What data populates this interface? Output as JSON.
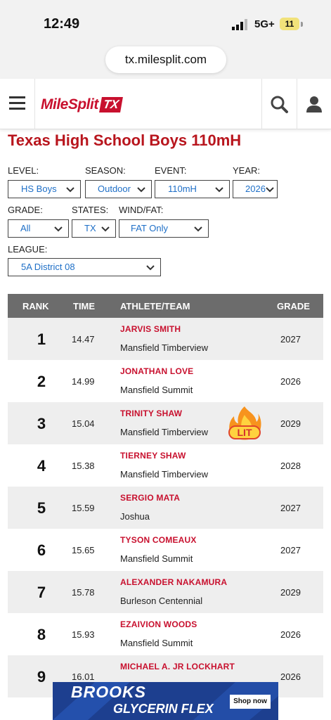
{
  "status_bar": {
    "time": "12:49",
    "network": "5G+",
    "battery": "11"
  },
  "browser": {
    "url": "tx.milesplit.com"
  },
  "header": {
    "logo_text": "MileSplit",
    "logo_badge": "TX"
  },
  "page": {
    "title": "Texas High School Boys 110mH"
  },
  "filters": {
    "level": {
      "label": "LEVEL:",
      "value": "HS Boys"
    },
    "season": {
      "label": "SEASON:",
      "value": "Outdoor"
    },
    "event": {
      "label": "EVENT:",
      "value": "110mH"
    },
    "year": {
      "label": "YEAR:",
      "value": "2026"
    },
    "grade": {
      "label": "GRADE:",
      "value": "All"
    },
    "states": {
      "label": "STATES:",
      "value": "TX"
    },
    "wind": {
      "label": "WIND/FAT:",
      "value": "FAT Only"
    },
    "league": {
      "label": "LEAGUE:",
      "value": "5A District 08"
    }
  },
  "table": {
    "headers": {
      "rank": "RANK",
      "time": "TIME",
      "athlete": "ATHLETE/TEAM",
      "grade": "GRADE"
    },
    "rows": [
      {
        "rank": "1",
        "time": "14.47",
        "name": "JARVIS SMITH",
        "team": "Mansfield Timberview",
        "grade": "2027"
      },
      {
        "rank": "2",
        "time": "14.99",
        "name": "JONATHAN LOVE",
        "team": "Mansfield Summit",
        "grade": "2026"
      },
      {
        "rank": "3",
        "time": "15.04",
        "name": "TRINITY SHAW",
        "team": "Mansfield Timberview",
        "grade": "2029"
      },
      {
        "rank": "4",
        "time": "15.38",
        "name": "TIERNEY SHAW",
        "team": "Mansfield Timberview",
        "grade": "2028"
      },
      {
        "rank": "5",
        "time": "15.59",
        "name": "SERGIO MATA",
        "team": "Joshua",
        "grade": "2027"
      },
      {
        "rank": "6",
        "time": "15.65",
        "name": "TYSON COMEAUX",
        "team": "Mansfield Summit",
        "grade": "2027"
      },
      {
        "rank": "7",
        "time": "15.78",
        "name": "ALEXANDER NAKAMURA",
        "team": "Burleson Centennial",
        "grade": "2029"
      },
      {
        "rank": "8",
        "time": "15.93",
        "name": "EZAIVION WOODS",
        "team": "Mansfield Summit",
        "grade": "2026"
      },
      {
        "rank": "9",
        "time": "16.01",
        "name": "MICHAEL A. JR LOCKHART",
        "team": "",
        "grade": "2026"
      }
    ]
  },
  "sticker": {
    "text": "LIT"
  },
  "ad": {
    "brand": "BROOKS",
    "product": "GLYCERIN FLEX",
    "cta": "Shop now"
  },
  "colors": {
    "brand_red": "#c8102e",
    "link_blue": "#1e6fc7",
    "table_header": "#6c6c6c"
  }
}
